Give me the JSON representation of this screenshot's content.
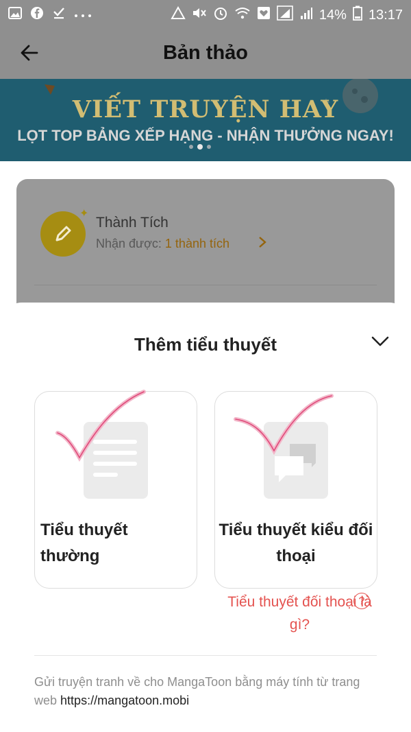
{
  "status_bar": {
    "battery": "14%",
    "time": "13:17",
    "icons_left": [
      "image-icon",
      "facebook-icon",
      "check-download-icon",
      "more-icon"
    ],
    "icons_right": [
      "recycle-icon",
      "mute-icon",
      "alarm-icon",
      "wifi-icon",
      "heart-icon",
      "signal-icon",
      "signal-icon",
      "battery-icon"
    ]
  },
  "header": {
    "title": "Bản thảo"
  },
  "banner": {
    "title": "VIẾT TRUYỆN HAY",
    "subtitle": "LỌT TOP BẢNG XẾP HẠNG - NHẬN THƯỞNG NGAY!"
  },
  "achievement": {
    "title": "Thành Tích",
    "label": "Nhận được:",
    "count": "1 thành tích"
  },
  "sheet": {
    "title": "Thêm tiểu thuyết",
    "options": [
      {
        "label": "Tiểu thuyết thường"
      },
      {
        "label": "Tiểu thuyết kiểu đối thoại"
      }
    ],
    "help_link": "Tiểu thuyết đối thoại là gì?",
    "help_icon": "?",
    "footer_text": "Gửi truyện tranh về cho MangaToon bằng máy tính từ trang web",
    "footer_link": "https://mangatoon.mobi"
  },
  "colors": {
    "accent": "#e4524f",
    "overlay": "#8f8f8f",
    "banner": "#1f5d70",
    "gold": "#a68d12"
  }
}
